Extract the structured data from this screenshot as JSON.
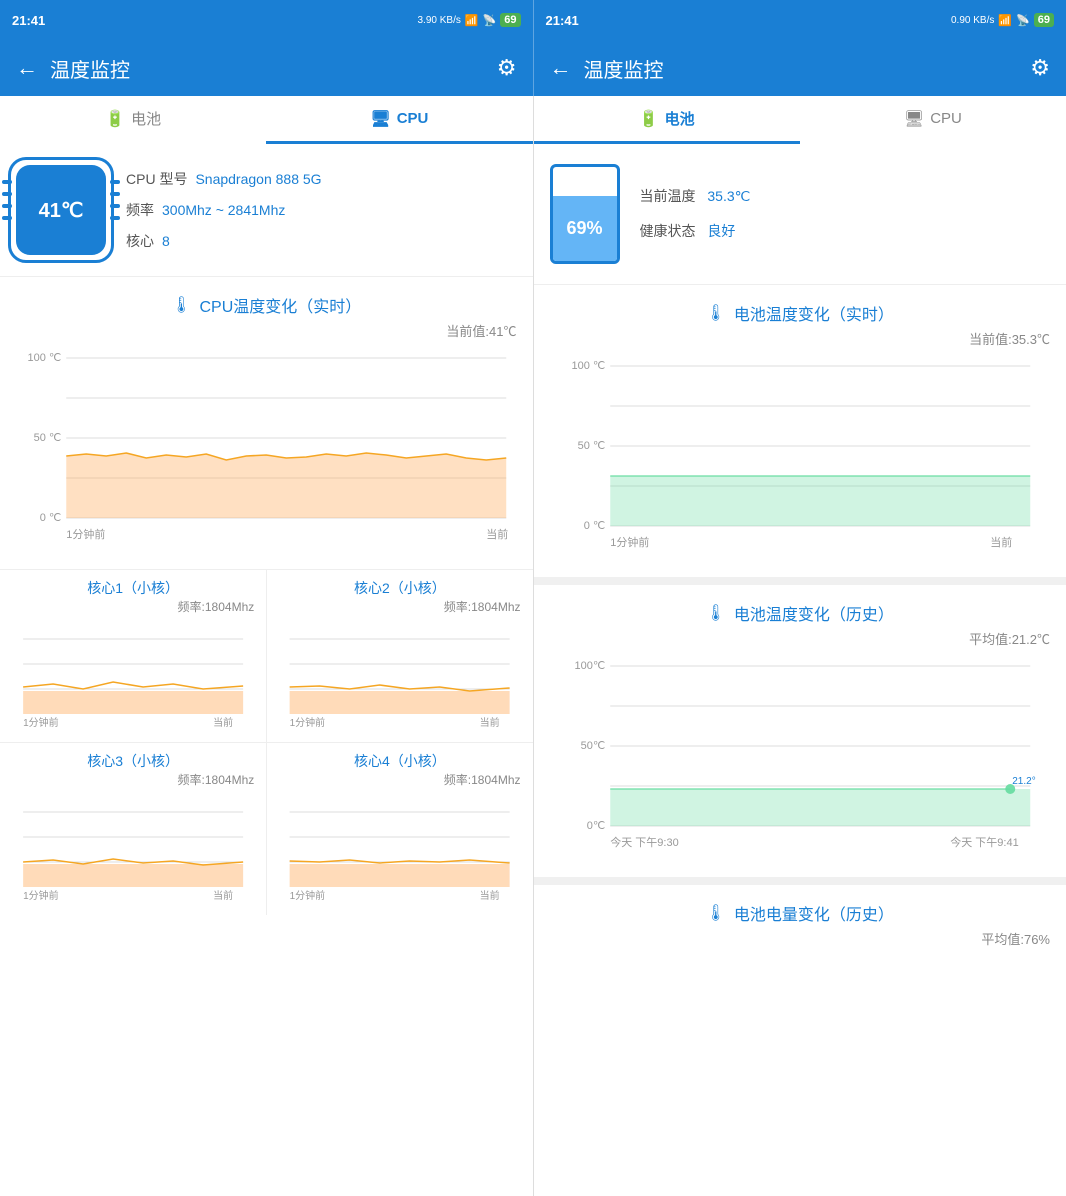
{
  "statusBar": {
    "left": {
      "time": "21:41",
      "networkSpeed": "3.90 KB/s",
      "battery": "69"
    },
    "right": {
      "time": "21:41",
      "networkSpeed": "0.90 KB/s",
      "battery": "69"
    }
  },
  "header": {
    "title": "温度监控",
    "backLabel": "←",
    "gearIcon": "⚙"
  },
  "tabs": {
    "left": [
      {
        "label": "电池",
        "icon": "🔋",
        "active": false
      },
      {
        "label": "CPU",
        "icon": "💻",
        "active": true
      }
    ],
    "right": [
      {
        "label": "电池",
        "icon": "🔋",
        "active": true
      },
      {
        "label": "CPU",
        "icon": "💻",
        "active": false
      }
    ]
  },
  "cpuPanel": {
    "chip": {
      "temp": "41℃"
    },
    "model_label": "CPU 型号",
    "model_value": "Snapdragon 888 5G",
    "freq_label": "频率",
    "freq_value": "300Mhz ~ 2841Mhz",
    "core_label": "核心",
    "core_value": "8",
    "chart_title": "CPU温度变化（实时）",
    "chart_current": "当前值:41℃",
    "chart_y_max": "100 ℃",
    "chart_y_mid": "50 ℃",
    "chart_y_min": "0 ℃",
    "chart_x_left": "1分钟前",
    "chart_x_right": "当前",
    "cores": [
      {
        "name": "核心1（小核）",
        "freq": "频率:1804Mhz"
      },
      {
        "name": "核心2（小核）",
        "freq": "频率:1804Mhz"
      },
      {
        "name": "核心3（小核）",
        "freq": "频率:1804Mhz"
      },
      {
        "name": "核心4（小核）",
        "freq": "频率:1804Mhz"
      }
    ]
  },
  "batteryPanel": {
    "percentage": "69%",
    "temp_label": "当前温度",
    "temp_value": "35.3℃",
    "health_label": "健康状态",
    "health_value": "良好",
    "realtime_title": "电池温度变化（实时）",
    "realtime_current": "当前值:35.3℃",
    "chart_y_max": "100 ℃",
    "chart_y_mid": "50 ℃",
    "chart_y_min": "0 ℃",
    "chart_x_left": "1分钟前",
    "chart_x_right": "当前",
    "history_title": "电池温度变化（历史）",
    "history_avg": "平均值:21.2℃",
    "history_y_max": "100℃",
    "history_y_mid": "50℃",
    "history_y_min": "0℃",
    "history_x_left": "今天 下午9:30",
    "history_x_right": "今天 下午9:41",
    "history_point_val": "21.2°",
    "charge_title": "电池电量变化（历史）",
    "charge_avg": "平均值:76%"
  }
}
